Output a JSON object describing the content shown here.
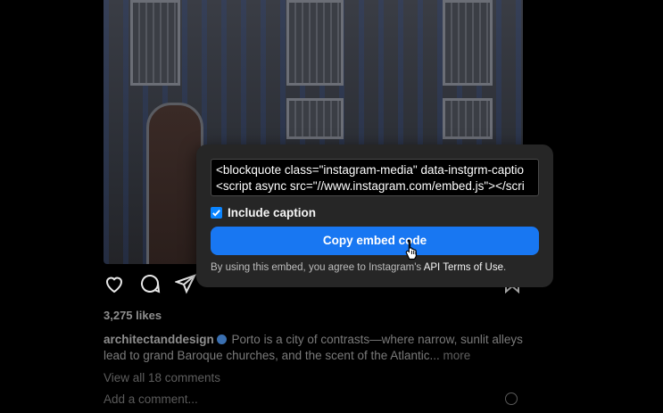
{
  "post": {
    "likes": "3,275 likes",
    "username": "architectanddesign",
    "caption": "Porto is a city of contrasts—where narrow, sunlit alleys lead to grand Baroque churches, and the scent of the Atlantic...",
    "more_label": "more",
    "view_comments": "View all 18 comments",
    "add_comment_placeholder": "Add a comment..."
  },
  "icons": {
    "like": "heart-icon",
    "comment": "comment-icon",
    "share": "paper-plane-icon",
    "save": "bookmark-icon",
    "emoji": "smiley-icon",
    "verified": "verified-badge-icon",
    "cursor": "hand-pointer-cursor"
  },
  "embed": {
    "code_line1": "<blockquote class=\"instagram-media\" data-instgrm-captio",
    "code_line2": "<script async src=\"//www.instagram.com/embed.js\"></scri",
    "include_caption_label": "Include caption",
    "include_caption_checked": true,
    "copy_button_label": "Copy embed code",
    "terms_prefix": "By using this embed, you agree to Instagram's ",
    "terms_link": "API Terms of Use",
    "terms_suffix": "."
  },
  "colors": {
    "accent_button": "#1877f2",
    "checkbox": "#0a84ff",
    "panel_bg": "#262626"
  }
}
